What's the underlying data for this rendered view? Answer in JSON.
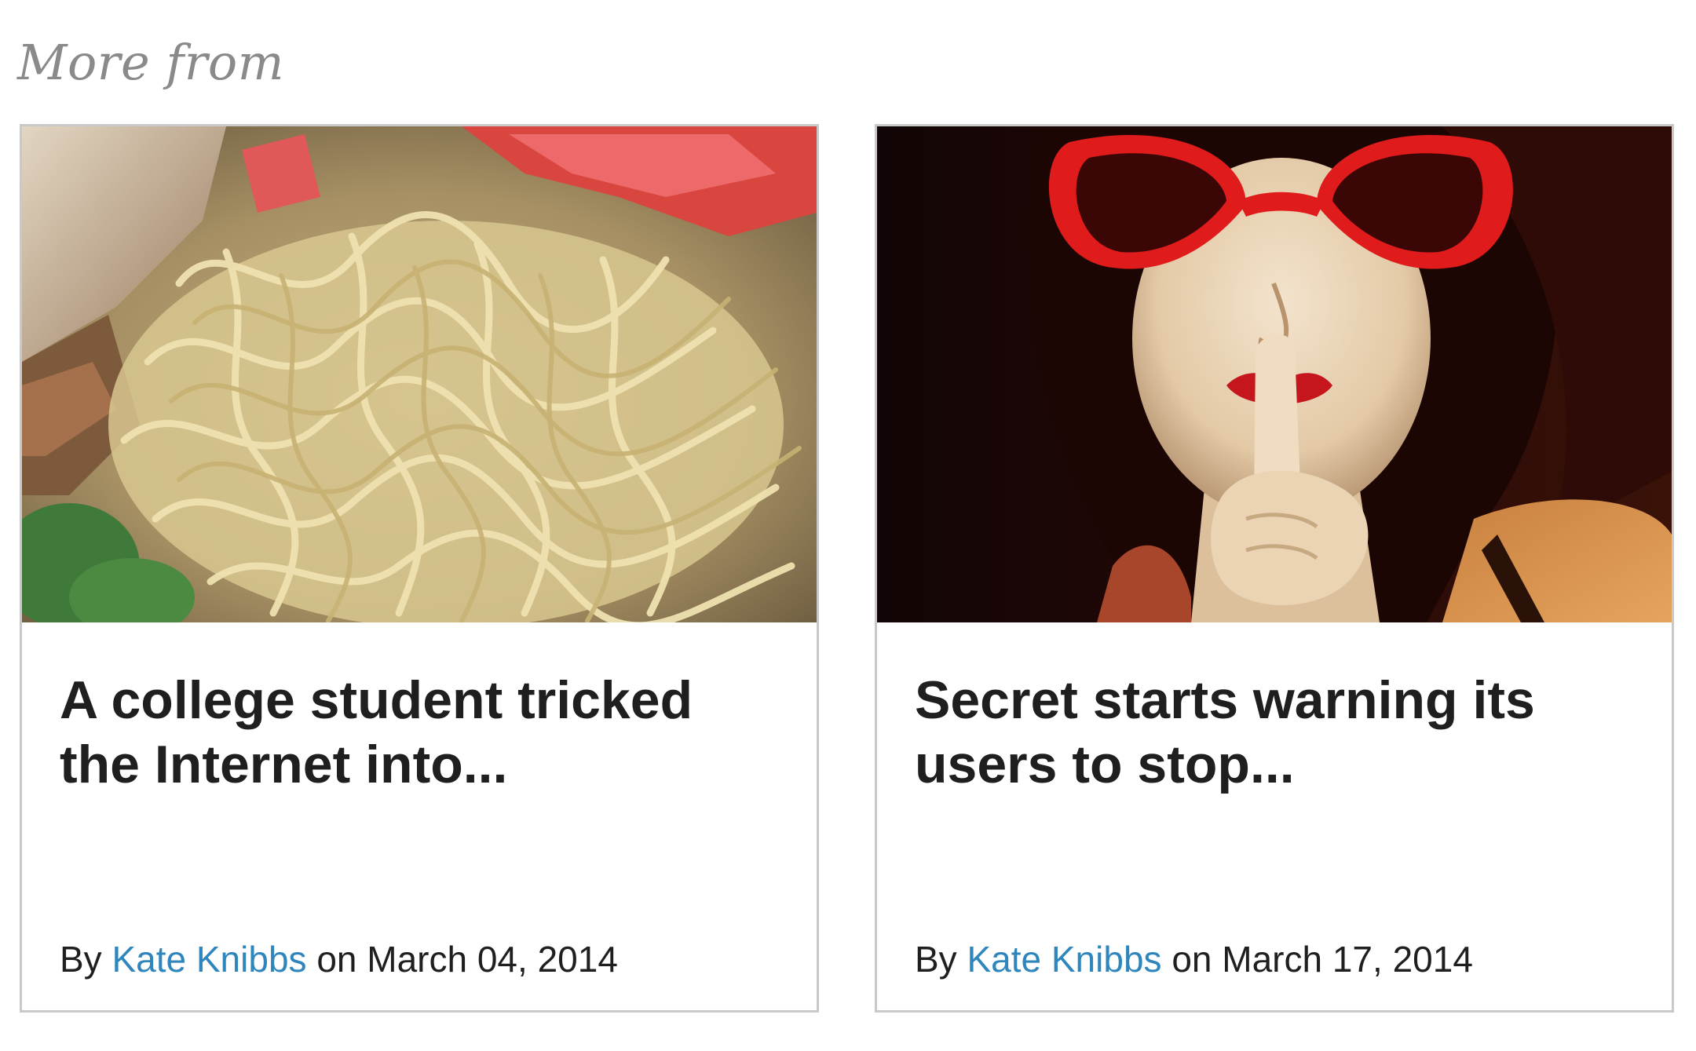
{
  "section": {
    "heading": "More from"
  },
  "cards": [
    {
      "title": "A college student tricked the Internet into...",
      "by_label": "By",
      "author": "Kate Knibbs",
      "on_label": "on",
      "date": "March 04, 2014",
      "image_subject": "bowl of ramen noodles"
    },
    {
      "title": "Secret starts warning its users to stop...",
      "by_label": "By",
      "author": "Kate Knibbs",
      "on_label": "on",
      "date": "March 17, 2014",
      "image_subject": "mannequin with red heart sunglasses making shush gesture"
    }
  ],
  "colors": {
    "heading": "#8a8a8a",
    "title": "#1f1f1f",
    "author_link": "#2f86bd",
    "card_border": "#c9c9c9"
  }
}
